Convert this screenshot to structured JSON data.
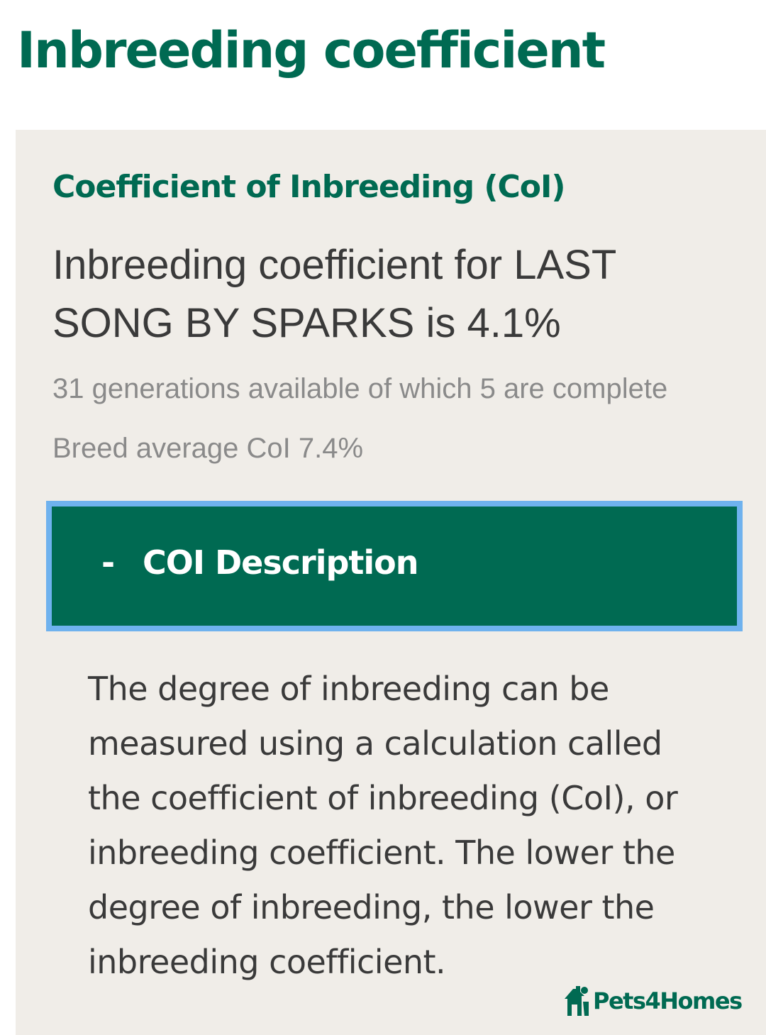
{
  "page": {
    "title": "Inbreeding coefficient"
  },
  "coi_card": {
    "heading": "Coefficient of Inbreeding (CoI)",
    "result_text": "Inbreeding coefficient for LAST SONG BY SPARKS is 4.1%",
    "generations_text": "31 generations available of which 5 are complete",
    "breed_average_text": "Breed average CoI 7.4%",
    "accordion": {
      "toggle_symbol": "-",
      "label": "COI Description",
      "expanded": true,
      "description": "The degree of inbreeding can be measured using a calculation called the coefficient of inbreeding (CoI), or inbreeding coefficient. The lower the degree of inbreeding, the lower the inbreeding coefficient."
    }
  },
  "brand": {
    "name": "Pets4Homes",
    "icon": "pets4homes-logo-icon"
  },
  "colors": {
    "brand_green": "#006a52",
    "card_background": "#f0ede8",
    "focus_outline": "#6fb2ee",
    "body_text": "#3a3a3a",
    "muted_text": "#8a8a8a"
  }
}
